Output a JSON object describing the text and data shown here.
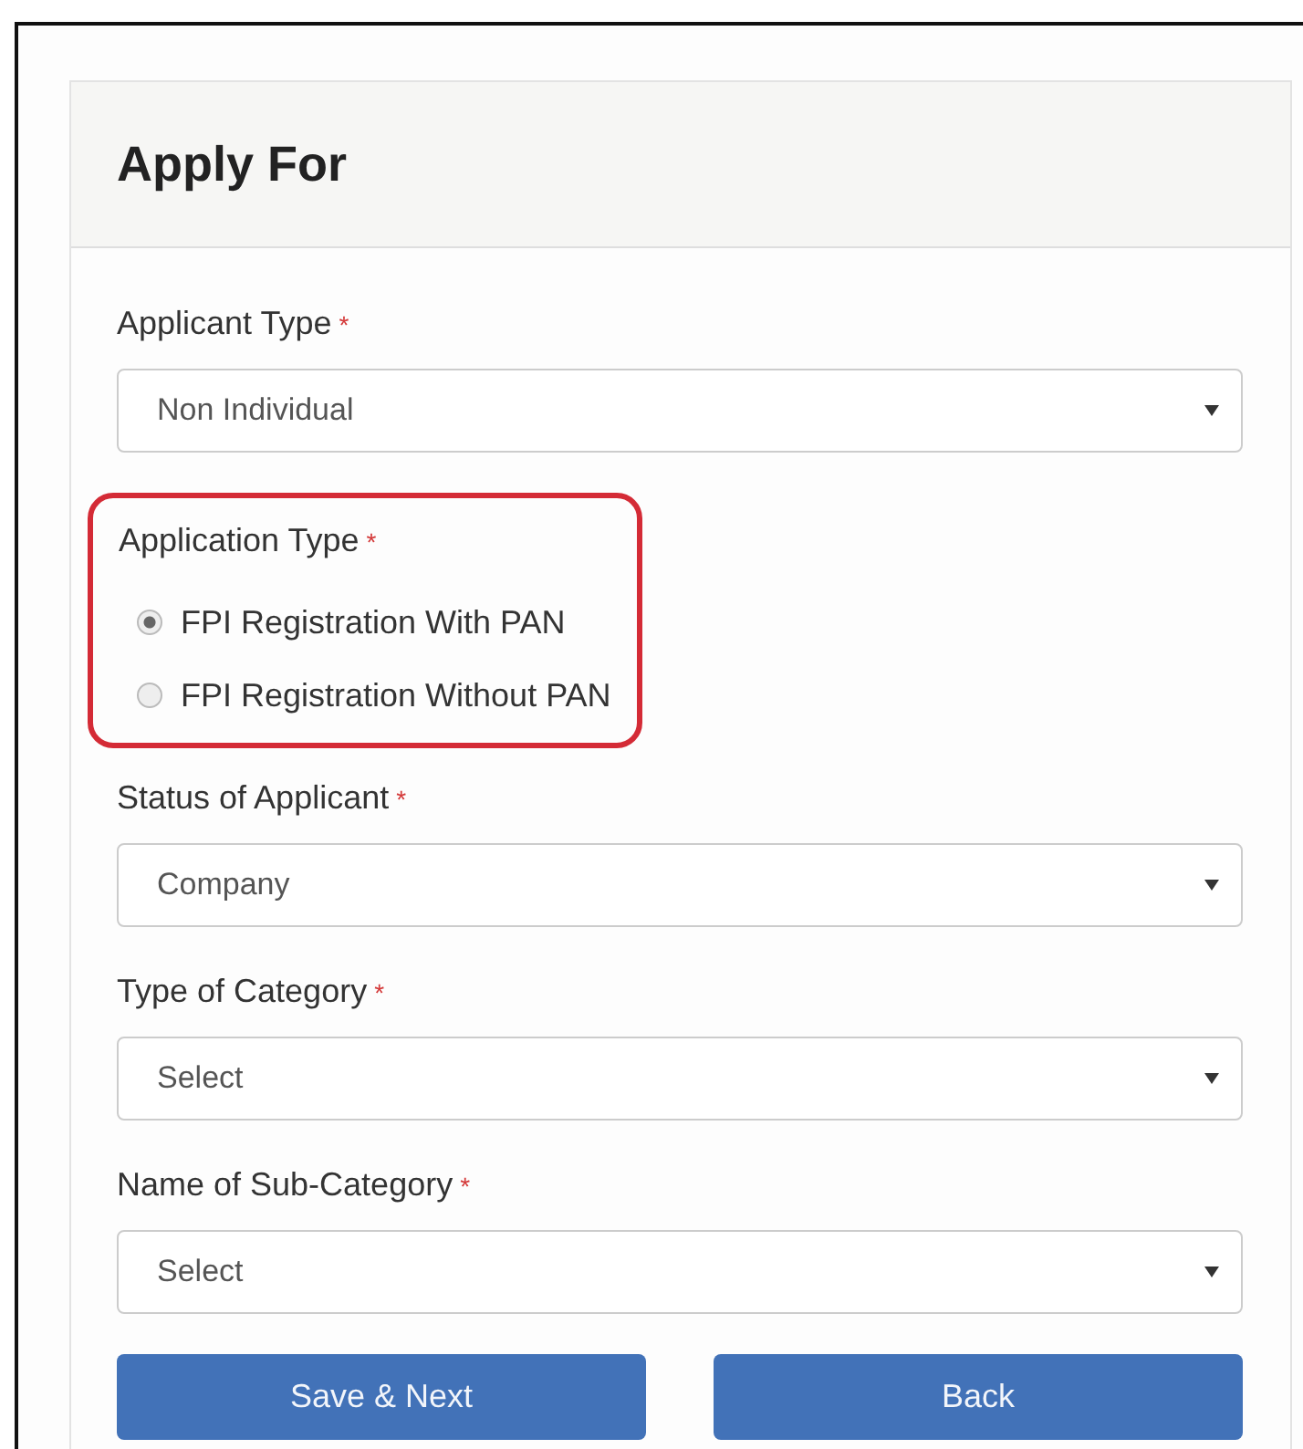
{
  "card": {
    "title": "Apply For"
  },
  "fields": [
    {
      "kind": "select",
      "label": "Applicant Type",
      "required_mark": "*",
      "highlighted": false,
      "value": "Non Individual"
    },
    {
      "kind": "radio",
      "label": "Application Type",
      "required_mark": "*",
      "highlighted": true,
      "options": [
        {
          "label": "FPI Registration With PAN",
          "selected": true
        },
        {
          "label": "FPI Registration Without PAN",
          "selected": false
        }
      ]
    },
    {
      "kind": "select",
      "label": "Status of Applicant",
      "required_mark": "*",
      "highlighted": false,
      "value": "Company"
    },
    {
      "kind": "select",
      "label": "Type of Category",
      "required_mark": "*",
      "highlighted": false,
      "value": "Select"
    },
    {
      "kind": "select",
      "label": "Name of Sub-Category",
      "required_mark": "*",
      "highlighted": false,
      "value": "Select"
    }
  ],
  "buttons": [
    "Save & Next",
    "Back"
  ]
}
